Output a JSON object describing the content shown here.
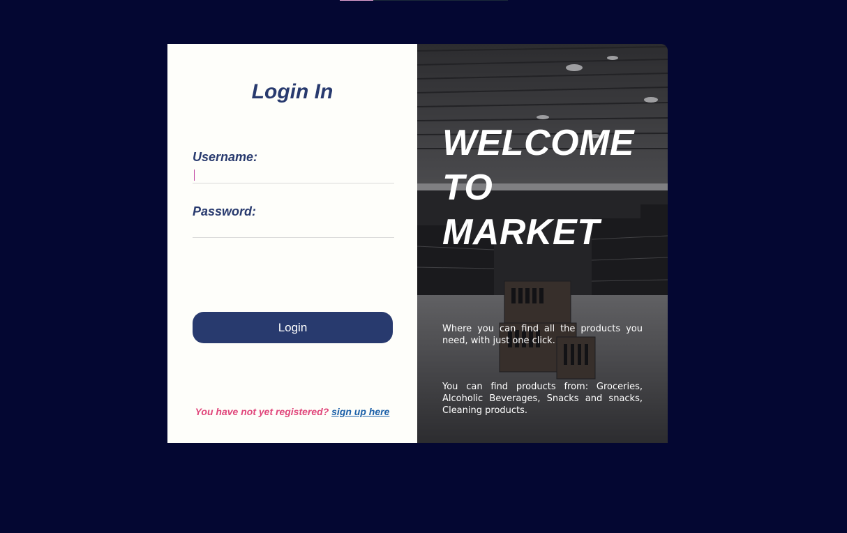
{
  "login": {
    "title": "Login In",
    "username_label": "Username:",
    "username_value": "",
    "password_label": "Password:",
    "password_value": "",
    "button_label": "Login",
    "register_question": "You have not yet registered?",
    "register_link": "sign up here"
  },
  "hero": {
    "welcome_lines": [
      "WELCOME",
      "TO",
      "MARKET"
    ],
    "description_1": "Where you can find all the products you need, with just one click.",
    "description_2": "You can find products from: Groceries, Alcoholic Beverages, Snacks and snacks, Cleaning products.",
    "image_subject": "supermarket aisle (grayscale)"
  },
  "colors": {
    "page_background": "#040732",
    "panel_background": "#fefefa",
    "primary": "#283a6e",
    "register_question": "#e0457a",
    "register_link": "#1a5fa8"
  }
}
